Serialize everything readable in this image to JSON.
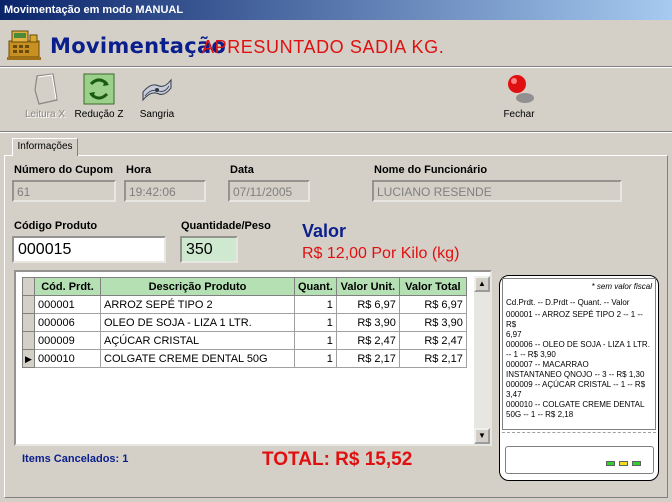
{
  "window": {
    "title": "Movimentação em modo MANUAL"
  },
  "header": {
    "title": "Movimentação",
    "product": "APRESUNTADO SADIA KG."
  },
  "toolbar": {
    "leitura_x": "Leitura X",
    "reducao_z": "Redução Z",
    "sangria": "Sangria",
    "fechar": "Fechar"
  },
  "tabs": {
    "info": "Informações"
  },
  "form": {
    "cupom_label": "Número do Cupom",
    "cupom_value": "61",
    "hora_label": "Hora",
    "hora_value": "19:42:06",
    "data_label": "Data",
    "data_value": "07/11/2005",
    "funcionario_label": "Nome do Funcionário",
    "funcionario_value": "LUCIANO RESENDE",
    "codigo_label": "Código Produto",
    "codigo_value": "000015",
    "quantidade_label": "Quantidade/Peso",
    "quantidade_value": "350"
  },
  "valor": {
    "title": "Valor",
    "text": "R$ 12,00 Por Kilo (kg)"
  },
  "grid": {
    "columns": [
      "Cód. Prdt.",
      "Descrição Produto",
      "Quant.",
      "Valor Unit.",
      "Valor Total"
    ],
    "rows": [
      [
        "000001",
        "ARROZ SEPÉ TIPO 2",
        "1",
        "R$ 6,97",
        "R$ 6,97"
      ],
      [
        "000006",
        "OLEO DE SOJA - LIZA 1 LTR.",
        "1",
        "R$ 3,90",
        "R$ 3,90"
      ],
      [
        "000009",
        "AÇÚCAR CRISTAL",
        "1",
        "R$ 2,47",
        "R$ 2,47"
      ],
      [
        "000010",
        "COLGATE CREME DENTAL 50G",
        "1",
        "R$ 2,17",
        "R$ 2,17"
      ]
    ]
  },
  "footer": {
    "cancelados": "Items Cancelados:  1",
    "total": "TOTAL: R$ 15,52"
  },
  "receipt": {
    "note": "* sem valor fiscal",
    "lines": [
      "Cd.Prdt. -- D.Prdt  -- Quant. -- Valor",
      "000001 -- ARROZ SEPÉ TIPO 2 -- 1 -- R$",
      "6,97",
      "000006 -- OLEO DE SOJA - LIZA 1 LTR.",
      "-- 1 -- R$ 3,90",
      "000007 -- MACARRAO",
      "INSTANTANEO QNOJO -- 3 -- R$ 1,30",
      "000009 -- AÇÚCAR CRISTAL -- 1 -- R$",
      "3,47",
      "000010 -- COLGATE CREME DENTAL",
      "50G -- 1 -- R$ 2,18"
    ]
  },
  "colors": {
    "title_blue": "#0a1e8c",
    "accent_red": "#e01010",
    "grid_header": "#b4e0b4"
  }
}
